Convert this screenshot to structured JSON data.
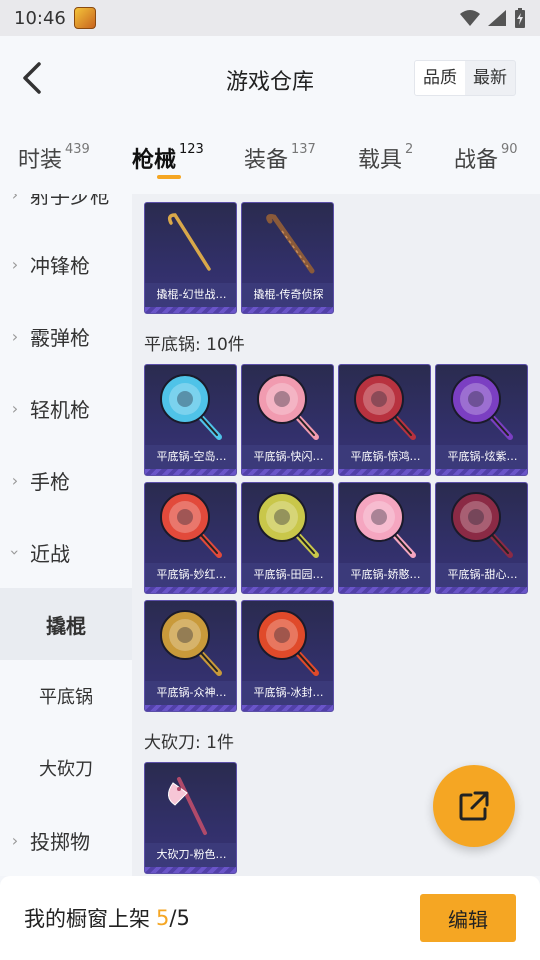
{
  "statusbar": {
    "time": "10:46"
  },
  "header": {
    "title": "游戏仓库",
    "sort_options": [
      "品质",
      "最新"
    ]
  },
  "tabs": [
    {
      "label": "时装",
      "count": "439"
    },
    {
      "label": "枪械",
      "count": "123"
    },
    {
      "label": "装备",
      "count": "137"
    },
    {
      "label": "载具",
      "count": "2"
    },
    {
      "label": "战备",
      "count": "90"
    }
  ],
  "sidebar": {
    "items": [
      {
        "label": "射手步枪"
      },
      {
        "label": "冲锋枪"
      },
      {
        "label": "霰弹枪"
      },
      {
        "label": "轻机枪"
      },
      {
        "label": "手枪"
      },
      {
        "label": "近战"
      },
      {
        "label": "撬棍"
      },
      {
        "label": "平底锅"
      },
      {
        "label": "大砍刀"
      },
      {
        "label": "投掷物"
      }
    ]
  },
  "content": {
    "crowbar_items": [
      {
        "name": "撬棍-幻世战…"
      },
      {
        "name": "撬棍-传奇侦探"
      }
    ],
    "pan_section": "平底锅: 10件",
    "pan_items": [
      {
        "name": "平底锅-空岛…",
        "color": "#4fc3e8"
      },
      {
        "name": "平底锅-快闪…",
        "color": "#f19bb0"
      },
      {
        "name": "平底锅-惊鸿…",
        "color": "#b8323f"
      },
      {
        "name": "平底锅-炫紫…",
        "color": "#7b3fc2"
      },
      {
        "name": "平底锅-妙红…",
        "color": "#e24a3b"
      },
      {
        "name": "平底锅-田园…",
        "color": "#c9c74a"
      },
      {
        "name": "平底锅-娇憨…",
        "color": "#f5a6c0"
      },
      {
        "name": "平底锅-甜心…",
        "color": "#8b2a45"
      },
      {
        "name": "平底锅-众神…",
        "color": "#c99a3a"
      },
      {
        "name": "平底锅-冰封…",
        "color": "#e04a2a"
      }
    ],
    "machete_section": "大砍刀: 1件",
    "machete_items": [
      {
        "name": "大砍刀-粉色…"
      }
    ]
  },
  "footer": {
    "label": "我的橱窗上架",
    "current": "5",
    "separator": "/",
    "max": "5",
    "edit_label": "编辑"
  },
  "colors": {
    "accent": "#f5a623"
  }
}
